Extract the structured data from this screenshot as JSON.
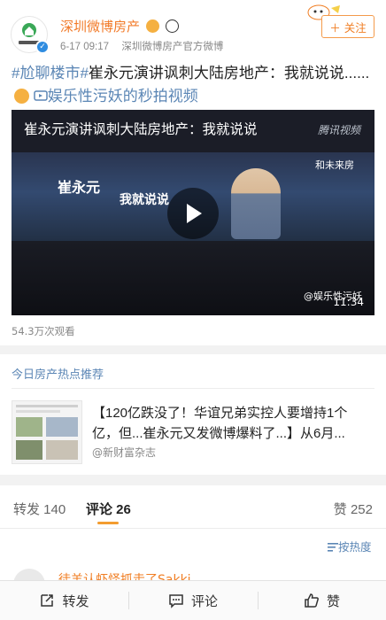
{
  "header": {
    "author": "深圳微博房产",
    "time": "6-17 09:17",
    "source": "深圳微博房产官方微博",
    "follow_label": "＋ 关注"
  },
  "post": {
    "topic": "#尬聊楼市#",
    "text_main": "崔永元演讲讽刺大陆房地产：我就说说......",
    "link_text": "娱乐性污妖的秒拍视频"
  },
  "video": {
    "title": "崔永元演讲讽刺大陆房地产：我就说说",
    "watermark": "腾讯视频",
    "stage_name": "崔永元",
    "stage_subtitle": "我就说说",
    "stage_logo": "和未来房",
    "tag": "@娱乐性污妖",
    "duration": "11:34",
    "views": "54.3万次观看"
  },
  "recommendation": {
    "title": "今日房产热点推荐",
    "headline": "【120亿跌没了！华谊兄弟实控人要增持1个亿，但...崔永元又发微博爆料了...】从6月...",
    "source": "@新财富杂志"
  },
  "tabs": {
    "repost": "转发 140",
    "comment": "评论 26",
    "like": "赞 252",
    "sort": "按热度"
  },
  "comment_peek": {
    "name": "徒羊认虾怪抓走了Sakki"
  },
  "bottom_bar": {
    "repost": "转发",
    "comment": "评论",
    "like": "赞"
  },
  "colors": {
    "accent_orange": "#f07d22",
    "link_blue": "#5b86b5",
    "tab_underline": "#f39c2f"
  }
}
